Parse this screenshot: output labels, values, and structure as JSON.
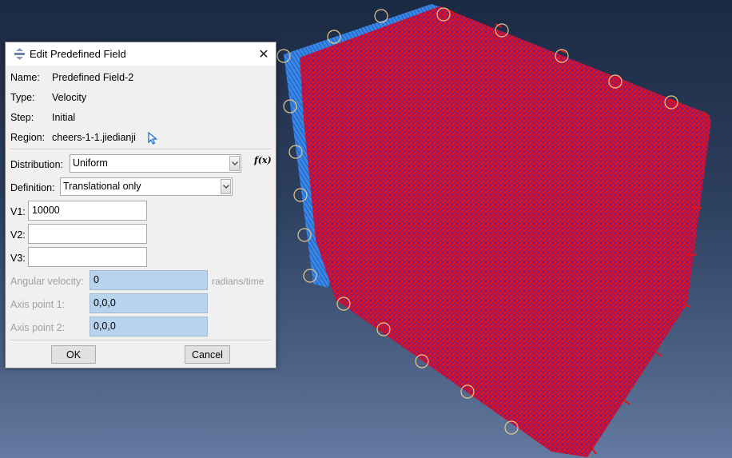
{
  "dialog": {
    "title": "Edit Predefined Field",
    "close_glyph": "✕",
    "info": {
      "name_label": "Name:",
      "name_value": "Predefined Field-2",
      "type_label": "Type:",
      "type_value": "Velocity",
      "step_label": "Step:",
      "step_value": "Initial",
      "region_label": "Region:",
      "region_value": "cheers-1-1.jiedianji"
    },
    "distribution": {
      "label": "Distribution:",
      "value": "Uniform"
    },
    "fx_label": "f(x)",
    "definition": {
      "label": "Definition:",
      "value": "Translational only"
    },
    "v1": {
      "label": "V1:",
      "value": "10000"
    },
    "v2": {
      "label": "V2:",
      "value": ""
    },
    "v3": {
      "label": "V3:",
      "value": ""
    },
    "angular_velocity": {
      "label": "Angular velocity:",
      "value": "0",
      "units": "radians/time"
    },
    "axis_point_1": {
      "label": "Axis point 1:",
      "value": "0,0,0"
    },
    "axis_point_2": {
      "label": "Axis point 2:",
      "value": "0,0,0"
    },
    "ok_label": "OK",
    "cancel_label": "Cancel"
  },
  "icons": {
    "app": "predefined-field-icon",
    "close": "close-icon",
    "select_region": "arrow-cursor-icon",
    "dropdown": "chevron-down-icon"
  },
  "colors": {
    "background_top": "#1b2a43",
    "background_bottom": "#647aa0",
    "mesh_front": "#e0101c",
    "mesh_side": "#3a86e6",
    "mesh_overlay": "#3030c0",
    "disabled_field": "#b8d3ee"
  }
}
